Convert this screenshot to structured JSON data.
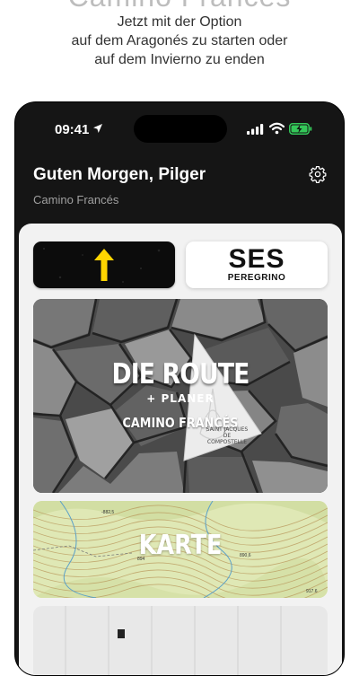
{
  "promo": {
    "heading": "Camino Francés",
    "subtitle_lines": [
      "Jetzt mit der Option",
      "auf dem Aragonés zu starten oder",
      "auf dem Invierno zu enden"
    ]
  },
  "status_bar": {
    "time": "09:41",
    "icons": [
      "location-arrow-icon",
      "cellular-signal-icon",
      "wifi-icon",
      "battery-charging-icon"
    ]
  },
  "header": {
    "greeting": "Guten Morgen, Pilger",
    "route": "Camino Francés",
    "settings_icon": "gear-icon"
  },
  "tiles": {
    "arrow_tile": {
      "icon": "yellow-up-arrow-icon"
    },
    "ses_tile": {
      "title": "SES",
      "subtitle": "PEREGRINO"
    },
    "route_tile": {
      "title": "DIE ROUTE",
      "subtitle": "+ PLANER",
      "caption": "CAMINO FRANCÉS",
      "pennant_text_1": "SAINT JACQUES",
      "pennant_text_2": "DE",
      "pennant_text_3": "COMPOSTELLE"
    },
    "map_tile": {
      "title": "KARTE",
      "elevations": [
        "-882,5",
        "894",
        "890,6",
        "917.6"
      ]
    }
  },
  "colors": {
    "phone_background": "#151515",
    "content_background": "#f2f2f2",
    "arrow_yellow": "#ffd400",
    "battery_green": "#34c759",
    "map_green": "#dfe8b5",
    "contour": "#b9975b"
  }
}
